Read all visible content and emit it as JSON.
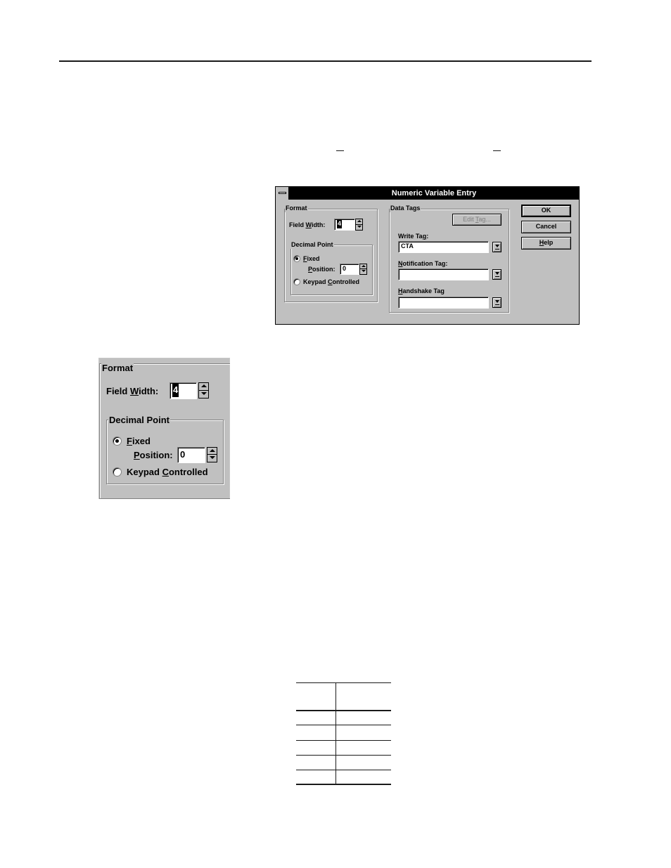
{
  "dialog": {
    "title": "Numeric Variable Entry",
    "format": {
      "group_label": "Format",
      "field_width_label": "Field Width:",
      "field_width_value": "4",
      "decimal_point": {
        "group_label": "Decimal Point",
        "fixed_label": "Fixed",
        "fixed_selected": true,
        "position_label": "Position:",
        "position_value": "0",
        "keypad_label": "Keypad Controlled",
        "keypad_selected": false
      }
    },
    "data_tags": {
      "group_label": "Data Tags",
      "edit_tag_button": "Edit Tag...",
      "write_tag_label": "Write Tag:",
      "write_tag_value": "CTA",
      "notification_tag_label": "Notification Tag:",
      "notification_tag_value": "",
      "handshake_tag_label": "Handshake Tag",
      "handshake_tag_value": ""
    },
    "buttons": {
      "ok": "OK",
      "cancel": "Cancel",
      "help": "Help"
    }
  },
  "callout": {
    "group_label": "Format",
    "field_width_label": "Field Width:",
    "field_width_value": "4",
    "decimal_group_label": "Decimal Point",
    "fixed_label": "Fixed",
    "position_label": "Position:",
    "position_value": "0",
    "keypad_label": "Keypad Controlled"
  },
  "table": {
    "rows": 5,
    "columns": 2
  }
}
